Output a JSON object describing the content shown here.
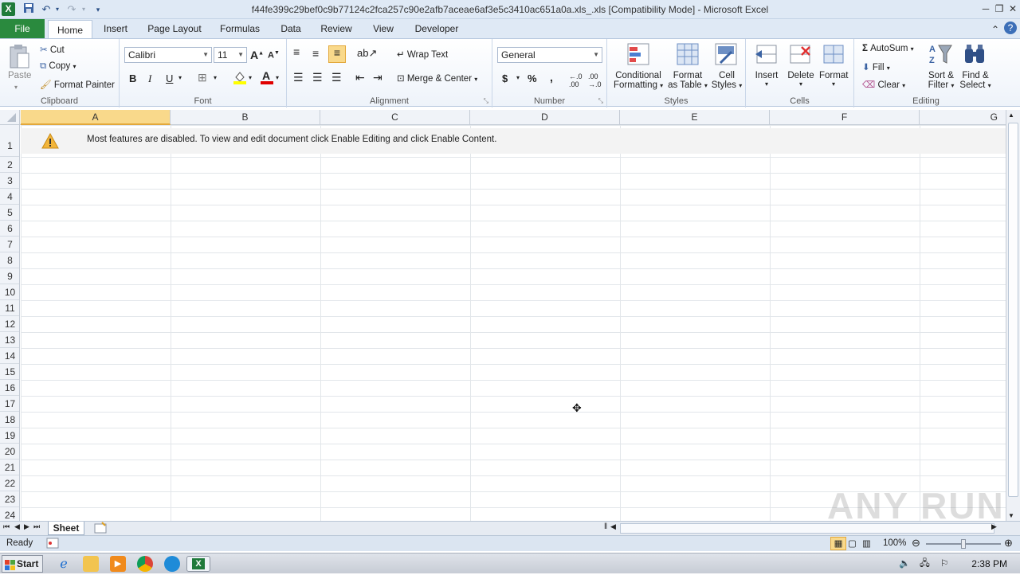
{
  "window": {
    "title": "f44fe399c29bef0c9b77124c2fca257c90e2afb7aceae6af3e5c3410ac651a0a.xls_.xls  [Compatibility Mode]  -  Microsoft Excel"
  },
  "tabs": [
    "File",
    "Home",
    "Insert",
    "Page Layout",
    "Formulas",
    "Data",
    "Review",
    "View",
    "Developer"
  ],
  "ribbon": {
    "clipboard": {
      "label": "Clipboard",
      "paste": "Paste",
      "cut": "Cut",
      "copy": "Copy",
      "format_painter": "Format Painter"
    },
    "font": {
      "label": "Font",
      "name": "Calibri",
      "size": "11",
      "bold": "B",
      "italic": "I",
      "underline": "U"
    },
    "alignment": {
      "label": "Alignment",
      "wrap": "Wrap Text",
      "merge": "Merge & Center"
    },
    "number": {
      "label": "Number",
      "format": "General",
      "currency": "$",
      "percent": "%",
      "comma": ","
    },
    "styles": {
      "label": "Styles",
      "conditional_1": "Conditional",
      "conditional_2": "Formatting",
      "format_table_1": "Format",
      "format_table_2": "as Table",
      "cell_styles_1": "Cell",
      "cell_styles_2": "Styles"
    },
    "cells": {
      "label": "Cells",
      "insert": "Insert",
      "delete": "Delete",
      "format": "Format"
    },
    "editing": {
      "label": "Editing",
      "autosum": "AutoSum",
      "fill": "Fill",
      "clear": "Clear",
      "sort_1": "Sort &",
      "sort_2": "Filter",
      "find_1": "Find &",
      "find_2": "Select"
    }
  },
  "columns": [
    "A",
    "B",
    "C",
    "D",
    "E",
    "F",
    "G"
  ],
  "rows": [
    "1",
    "2",
    "3",
    "4",
    "5",
    "6",
    "7",
    "8",
    "9",
    "10",
    "11",
    "12",
    "13",
    "14",
    "15",
    "16",
    "17",
    "18",
    "19",
    "20",
    "21",
    "22",
    "23",
    "24"
  ],
  "banner": {
    "text": "Most features are disabled. To view and edit document click Enable Editing and click Enable Content."
  },
  "sheet_tabs": [
    "Sheet"
  ],
  "status": {
    "ready": "Ready",
    "zoom": "100%"
  },
  "taskbar": {
    "start": "Start",
    "clock": "2:38 PM"
  },
  "watermark": "ANY RUN"
}
